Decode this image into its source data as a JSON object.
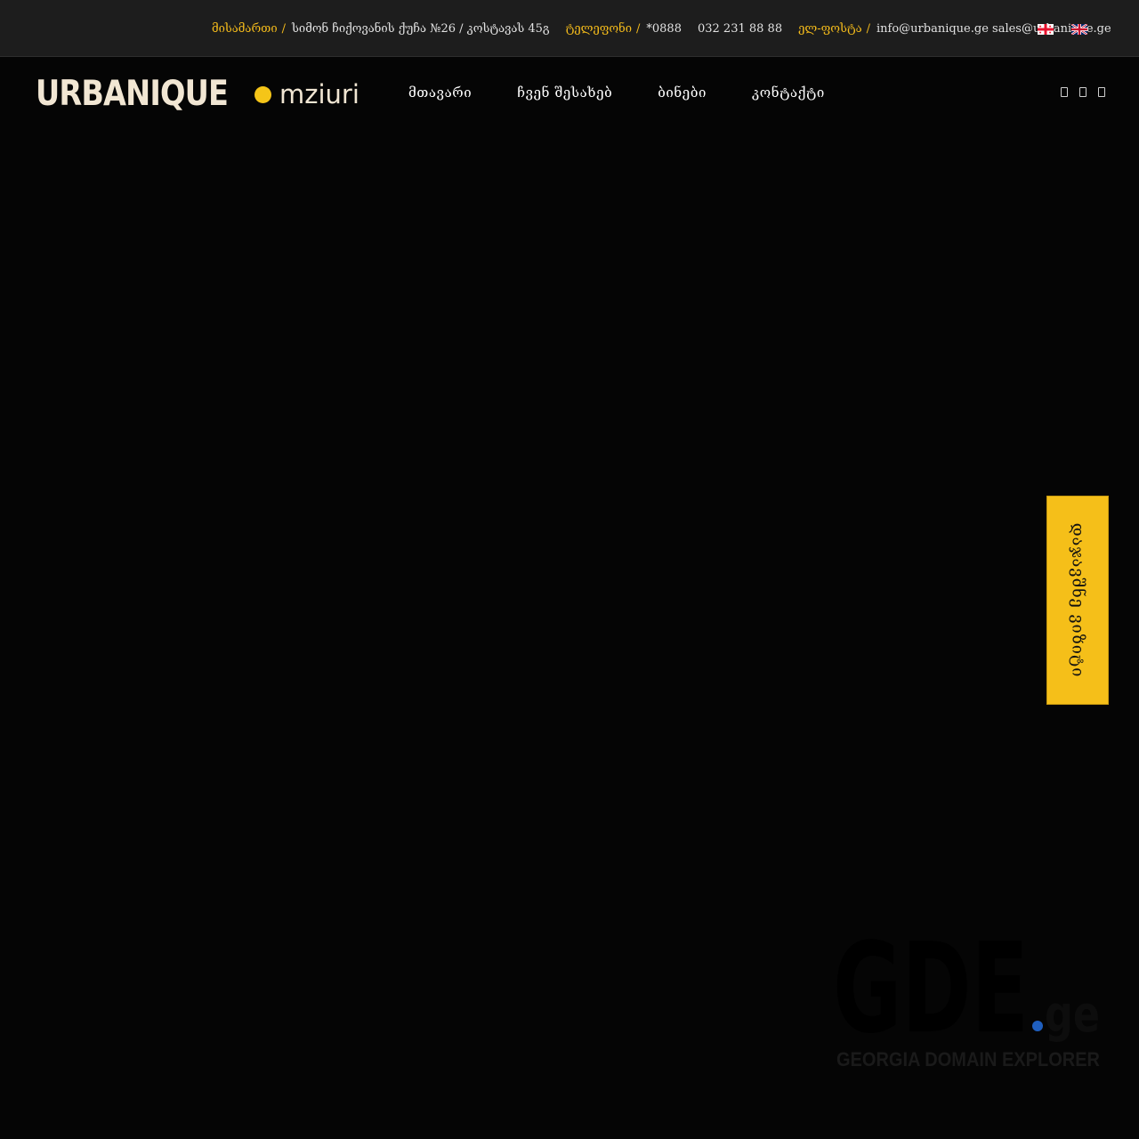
{
  "topbar": {
    "address_label": "მისამართი",
    "address_value": "სიმონ ჩიქოვანის ქუჩა №26 / კოსტავას 45გ",
    "phone_label": "ტელეფონი",
    "phone_short": "*0888",
    "phone_full": "032 231 88 88",
    "email_label": "ელ-ფოსტა",
    "email_value": "info@urbanique.ge sales@urbanique.ge",
    "separator": "/",
    "languages": [
      "georgian-flag-icon",
      "english-flag-icon"
    ]
  },
  "header": {
    "logo_word": "URBANIQUE",
    "logo_sub": "mziuri",
    "nav": [
      "მთავარი",
      "ჩვენ შესახებ",
      "ბინები",
      "კონტაქტი"
    ],
    "social_icons": [
      "facebook-icon",
      "instagram-icon",
      "youtube-icon"
    ]
  },
  "side_button": {
    "label": "დაჯავშნე ვიზიტი"
  },
  "watermark": {
    "logo_text": "GDE.ge",
    "caption": "GEORGIA DOMAIN EXPLORER"
  },
  "colors": {
    "accent": "#f5bf19",
    "background": "#050505",
    "topbar": "#1d1d1d",
    "logo": "#f1e6d3"
  }
}
